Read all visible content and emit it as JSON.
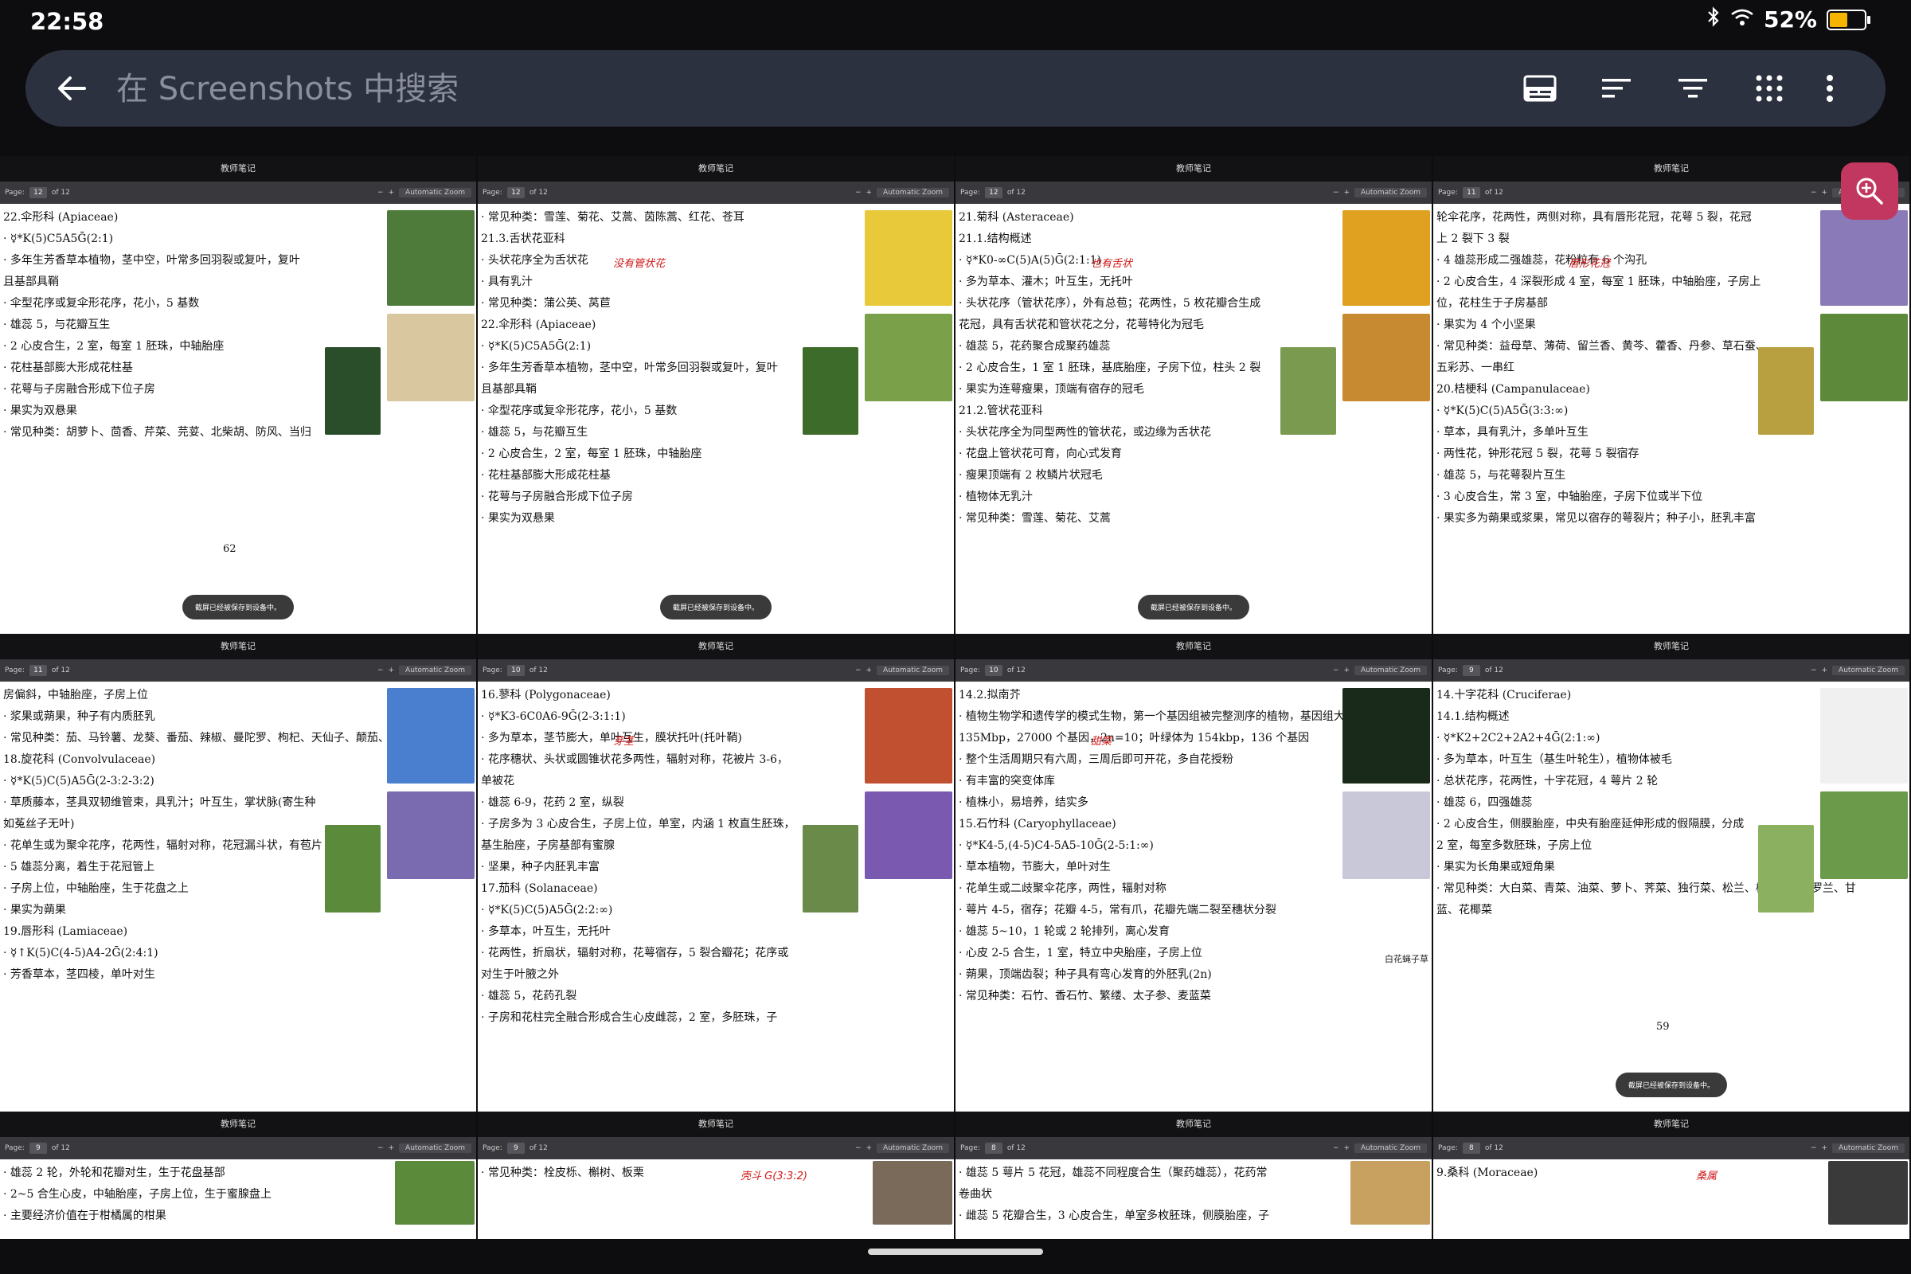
{
  "status_bar": {
    "time": "22:58",
    "battery": "52%",
    "battery_level": 0.52
  },
  "search": {
    "placeholder": "在 Screenshots 中搜索"
  },
  "toolbar_icons": [
    "subtitles-icon",
    "sort-icon",
    "filter-icon",
    "grid-view-icon",
    "more-vert-icon"
  ],
  "colors": {
    "background": "#0d0d0f",
    "search_bar": "#2c3140",
    "fab": "#c2375f",
    "annotation_red": "#d01818"
  },
  "thumbnails": [
    {
      "app_title": "教师笔记",
      "page": "12",
      "of": "of 12",
      "zoom": "Automatic Zoom",
      "lines": [
        "22.伞形科 (Apiaceae)",
        "· ☿*K(5)C5A5Ḡ(2:1)",
        "· 多年生芳香草本植物，茎中空，叶常多回羽裂或复叶，复叶",
        "且基部具鞘",
        "· 伞型花序或复伞形花序，花小，5 基数",
        "· 雄蕊 5，与花瓣互生",
        "· 2 心皮合生，2 室，每室 1 胚珠，中轴胎座",
        "· 花柱基部膨大形成花柱基",
        "· 花萼与子房融合形成下位子房",
        "· 果实为双悬果",
        "· 常见种类：胡萝卜、茴香、芹菜、芫荽、北柴胡、防风、当归"
      ],
      "page_num": "62",
      "toast": "截屏已经被保存到设备中。"
    },
    {
      "app_title": "教师笔记",
      "page": "12",
      "of": "of 12",
      "zoom": "Automatic Zoom",
      "lines": [
        "· 常见种类：雪莲、菊花、艾蒿、茵陈蒿、红花、苍耳",
        "",
        "21.3.舌状花亚科",
        "· 头状花序全为舌状花",
        "· 具有乳汁",
        "· 常见种类：蒲公英、莴苣",
        "",
        "22.伞形科 (Apiaceae)",
        "· ☿*K(5)C5A5Ḡ(2:1)",
        "· 多年生芳香草本植物，茎中空，叶常多回羽裂或复叶，复叶",
        "且基部具鞘",
        "· 伞型花序或复伞形花序，花小，5 基数",
        "· 雄蕊 5，与花瓣互生",
        "· 2 心皮合生，2 室，每室 1 胚珠，中轴胎座",
        "· 花柱基部膨大形成花柱基",
        "· 花萼与子房融合形成下位子房",
        "· 果实为双悬果"
      ],
      "toast": "截屏已经被保存到设备中。",
      "note": "没有管状花"
    },
    {
      "app_title": "教师笔记",
      "page": "12",
      "of": "of 12",
      "zoom": "Automatic Zoom",
      "lines": [
        "21.菊科 (Asteraceae)",
        "21.1.结构概述",
        "· ☿*K0-∞C(5)A(5)Ḡ(2:1:1)",
        "· 多为草本、灌木；叶互生，无托叶",
        "· 头状花序（管状花序），外有总苞；花两性，5 枚花瓣合生成",
        "花冠，具有舌状花和管状花之分，花萼特化为冠毛",
        "· 雄蕊 5，花药聚合成聚药雄蕊",
        "· 2 心皮合生，1 室 1 胚珠，基底胎座，子房下位，柱头 2 裂",
        "· 果实为连萼瘦果，顶端有宿存的冠毛",
        "",
        "21.2.管状花亚科",
        "· 头状花序全为同型两性的管状花，或边缘为舌状花",
        "· 花盘上管状花可育，向心式发育",
        "· 瘦果顶端有 2 枚鳞片状冠毛",
        "· 植物体无乳汁",
        "· 常见种类：雪莲、菊花、艾蒿"
      ],
      "toast": "截屏已经被保存到设备中。",
      "note": "也有舌状"
    },
    {
      "app_title": "教师笔记",
      "page": "11",
      "of": "of 12",
      "zoom": "Automatic Zoom",
      "lines": [
        "轮伞花序，花两性，两侧对称，具有唇形花冠，花萼 5 裂，花冠",
        "上 2 裂下 3 裂",
        "· 4 雄蕊形成二强雄蕊，花粉粒有 6 个沟孔",
        "· 2 心皮合生，4 深裂形成 4 室，每室 1 胚珠，中轴胎座，子房上",
        "位，花柱生于子房基部",
        "· 果实为 4 个小坚果",
        "· 常见种类：益母草、薄荷、留兰香、黄芩、藿香、丹参、草石蚕、",
        "五彩苏、一串红",
        "",
        "20.桔梗科 (Campanulaceae)",
        "· ☿*K(5)C(5)A5Ḡ(3:3:∞)",
        "· 草本，具有乳汁，多单叶互生",
        "· 两性花，钟形花冠 5 裂，花萼 5 裂宿存",
        "· 雄蕊 5，与花萼裂片互生",
        "· 3 心皮合生，常 3 室，中轴胎座，子房下位或半下位",
        "· 果实多为蒴果或浆果，常见以宿存的萼裂片；种子小，胚乳丰富"
      ],
      "note": "唇形花冠"
    },
    {
      "app_title": "教师笔记",
      "page": "11",
      "of": "of 12",
      "zoom": "Automatic Zoom",
      "lines": [
        "房偏斜，中轴胎座，子房上位",
        "· 浆果或蒴果，种子有内质胚乳",
        "· 常见种类：茄、马铃薯、龙葵、番茄、辣椒、曼陀罗、枸杞、天仙子、颠茄、烟草",
        "",
        "18.旋花科 (Convolvulaceae)",
        "· ☿*K(5)C(5)A5Ḡ(2-3:2-3:2)",
        "· 草质藤本，茎具双韧维管束，具乳汁；叶互生，掌状脉(寄生种",
        "如菟丝子无叶)",
        "· 花单生或为聚伞花序，花两性，辐射对称，花冠漏斗状，有苞片",
        "· 5 雄蕊分离，着生于花冠管上",
        "· 子房上位，中轴胎座，生于花盘之上",
        "· 果实为蒴果",
        "",
        "19.唇形科 (Lamiaceae)",
        "· ☿↑K(5)C(4-5)A4-2Ḡ(2:4:1)",
        "· 芳香草本，茎四棱，单叶对生"
      ]
    },
    {
      "app_title": "教师笔记",
      "page": "10",
      "of": "of 12",
      "zoom": "Automatic Zoom",
      "lines": [
        "16.蓼科 (Polygonaceae)",
        "· ☿*K3-6C0A6-9Ḡ(2-3:1:1)",
        "· 多为草本，茎节膨大，单叶互生，膜状托叶(托叶鞘)",
        "· 花序穗状、头状或圆锥状花多两性，辐射对称，花被片 3-6，",
        "单被花",
        "· 雄蕊 6-9，花药 2 室，纵裂",
        "· 子房多为 3 心皮合生，子房上位，单室，内涵 1 枚直生胚珠，",
        "基生胎座，子房基部有蜜腺",
        "· 坚果，种子内胚乳丰富",
        "",
        "17.茄科 (Solanaceae)",
        "· ☿*K(5)C(5)A5Ḡ(2:2:∞)",
        "· 多草本，叶互生，无托叶",
        "· 花两性，折扇状，辐射对称，花萼宿存，5 裂合瓣花；花序或",
        "对生于叶腋之外",
        "· 雄蕊 5，花药孔裂",
        "· 子房和花柱完全融合形成合生心皮雌蕊，2 室，多胚珠，子"
      ],
      "note": "芽茎"
    },
    {
      "app_title": "教师笔记",
      "page": "10",
      "of": "of 12",
      "zoom": "Automatic Zoom",
      "lines": [
        "14.2.拟南芥",
        "· 植物生物学和遗传学的模式生物，第一个基因组被完整测序的植物，基因组大小",
        "135Mbp，27000 个基因，2n=10；叶绿体为 154kbp，136 个基因",
        "· 整个生活周期只有六周，三周后即可开花，多自花授粉",
        "· 有丰富的突变体库",
        "· 植株小，易培养，结实多",
        "",
        "",
        "15.石竹科 (Caryophyllaceae)",
        "· ☿*K4-5,(4-5)C4-5A5-10Ḡ(2-5:1:∞)",
        "· 草本植物，节膨大，单叶对生",
        "· 花单生或二歧聚伞花序，两性，辐射对称",
        "· 萼片 4-5，宿存；花瓣 4-5，常有爪，花瓣先端二裂至穗状分裂",
        "· 雄蕊 5~10，1 轮或 2 轮排列，离心发育",
        "· 心皮 2-5 合生，1 室，特立中央胎座，子房上位",
        "· 蒴果，顶端齿裂；种子具有弯心发育的外胚乳(2n)",
        "· 常见种类：石竹、香石竹、繁缕、太子参、麦蓝菜"
      ],
      "note": "甜菜",
      "image_label": "白花蝇子草"
    },
    {
      "app_title": "教师笔记",
      "page": "9",
      "of": "of 12",
      "zoom": "Automatic Zoom",
      "lines": [
        "14.十字花科 (Cruciferae)",
        "14.1.结构概述",
        "· ☿*K2+2C2+2A2+4Ḡ(2:1:∞)",
        "· 多为草本，叶互生（基生叶轮生），植物体被毛",
        "· 总状花序，花两性，十字花冠，4 萼片 2 轮",
        "· 雄蕊 6，四强雄蕊",
        "· 2 心皮合生，侧膜胎座，中央有胎座延伸形成的假隔膜，分成",
        "2 室，每室多数胚珠，子房上位",
        "· 果实为长角果或短角果",
        "· 常见种类：大白菜、青菜、油菜、萝卜、荠菜、独行菜、松兰、桂竹香、紫罗兰、甘",
        "蓝、花椰菜"
      ],
      "page_num": "59",
      "toast": "截屏已经被保存到设备中。"
    },
    {
      "app_title": "教师笔记",
      "page": "9",
      "of": "of 12",
      "zoom": "Automatic Zoom",
      "lines": [
        "· 雄蕊 2 轮，外轮和花瓣对生，生于花盘基部",
        "· 2~5 合生心皮，中轴胎座，子房上位，生于蜜腺盘上",
        "· 主要经济价值在于柑橘属的柑果"
      ]
    },
    {
      "app_title": "教师笔记",
      "page": "9",
      "of": "of 12",
      "zoom": "Automatic Zoom",
      "lines": [
        "· 常见种类：栓皮栎、槲树、板栗"
      ],
      "note": "壳斗 G(3:3:2)"
    },
    {
      "app_title": "教师笔记",
      "page": "8",
      "of": "of 12",
      "zoom": "Automatic Zoom",
      "lines": [
        "· 雄蕊 5 萼片 5 花冠，雄蕊不同程度合生（聚药雄蕊），花药常",
        "卷曲状",
        "· 雌蕊 5 花瓣合生，3 心皮合生，单室多枚胚珠，侧膜胎座，子"
      ]
    },
    {
      "app_title": "教师笔记",
      "page": "8",
      "of": "of 12",
      "zoom": "Automatic Zoom",
      "lines": [
        "",
        "",
        "9.桑科 (Moraceae)"
      ],
      "note": "桑属"
    }
  ]
}
